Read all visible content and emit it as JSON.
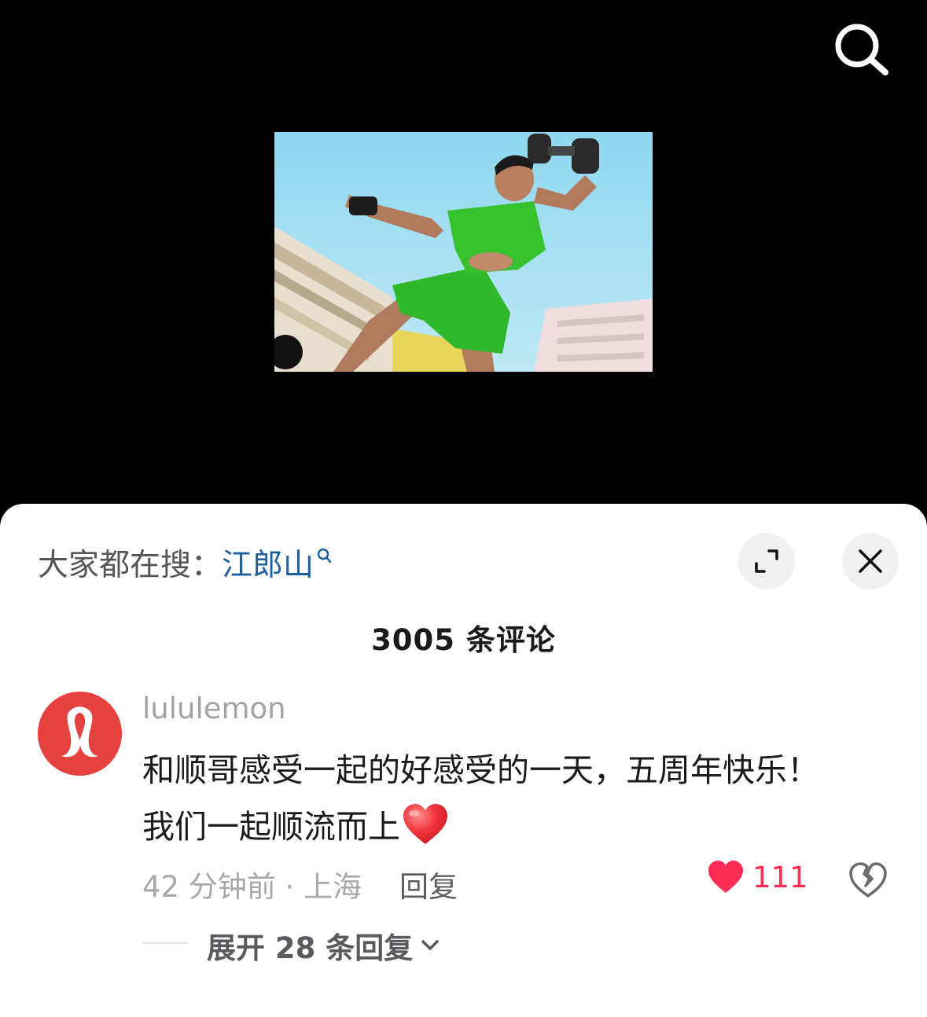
{
  "top_bar": {
    "search_icon": "search-icon"
  },
  "video": {
    "thumbnail": "man-lifting-dumbbell-green-outfit"
  },
  "sheet": {
    "hot_search_prefix": "大家都在搜：",
    "hot_search_keyword": "江郎山",
    "comment_count": "3005 条评论",
    "expand_icon": "expand-icon",
    "close_icon": "close-icon"
  },
  "comment": {
    "avatar": "lululemon-logo",
    "username": "lululemon",
    "text_line1": "和顺哥感受一起的好感受的一天，五周年快乐！",
    "text_line2": "我们一起顺流而上",
    "emoji": "red-heart-emoji",
    "meta": "42 分钟前 · 上海",
    "reply_label": "回复",
    "like_count": "111",
    "like_color": "#ff2c55",
    "expand_replies_label": "展开 28 条回复"
  }
}
